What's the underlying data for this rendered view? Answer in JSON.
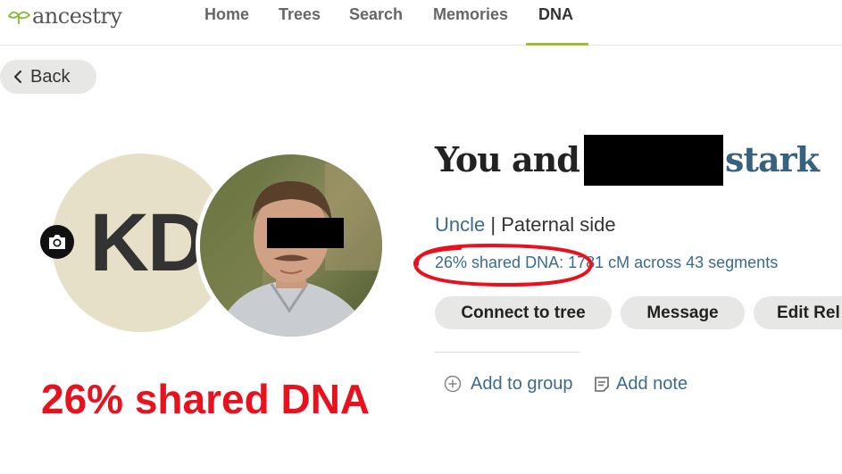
{
  "header": {
    "logo_text": "ancestry",
    "nav": [
      {
        "label": "Home"
      },
      {
        "label": "Trees"
      },
      {
        "label": "Search"
      },
      {
        "label": "Memories"
      },
      {
        "label": "DNA",
        "active": true
      }
    ]
  },
  "back_label": "Back",
  "profile": {
    "initials": "KD",
    "shared_dna_big": "26% shared DNA"
  },
  "match": {
    "title_prefix": "You and",
    "surname": "stark",
    "relationship": "Uncle",
    "separator": " | ",
    "side": "Paternal side",
    "shared_dna": "26% shared DNA:",
    "shared_details": " 1781 cM across 43 segments",
    "buttons": {
      "connect": "Connect to tree",
      "message": "Message",
      "edit": "Edit Rel"
    },
    "actions": {
      "add_group": "Add to group",
      "add_note": "Add note"
    }
  },
  "colors": {
    "accent_green": "#9cbe30",
    "link_blue": "#3a6b8c",
    "annotation_red": "#e8121f"
  },
  "icons": [
    "leaf-logo-icon",
    "chevron-left-icon",
    "camera-icon",
    "plus-circle-icon",
    "note-icon"
  ]
}
